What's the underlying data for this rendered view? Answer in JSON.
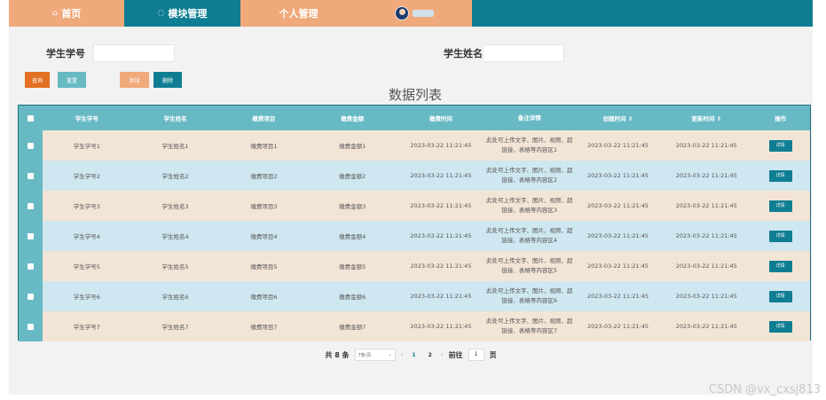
{
  "nav": {
    "home": "首页",
    "module": "模块管理",
    "personal": "个人管理"
  },
  "search": {
    "student_no_label": "学生学号",
    "student_name_label": "学生姓名",
    "student_no_value": "",
    "student_name_value": ""
  },
  "buttons": {
    "query": "查询",
    "reset": "重置",
    "add": "添加",
    "delete": "删除"
  },
  "colors": {
    "orange": "#f0a97a",
    "teal": "#0f7e93",
    "query_btn": "#e37022",
    "reset_btn": "#67b9c4",
    "add_btn": "#f0a97a",
    "delete_btn": "#0f7e93"
  },
  "list_title": "数据列表",
  "table": {
    "headers": [
      "学生学号",
      "学生姓名",
      "缴费项目",
      "缴费金额",
      "缴费时间",
      "备注详情",
      "创建时间 ⇕",
      "更新时间 ⇕",
      "操作"
    ],
    "detail_label": "详情",
    "rows": [
      [
        "学生学号1",
        "学生姓名1",
        "缴费项目1",
        "缴费金额1",
        "2023-03-22 11:21:45",
        "此处可上传文字、图片、视频、超链接、表格等内容区1",
        "2023-03-22 11:21:45",
        "2023-03-22 11:21:45"
      ],
      [
        "学生学号2",
        "学生姓名2",
        "缴费项目2",
        "缴费金额2",
        "2023-03-22 11:21:45",
        "此处可上传文字、图片、视频、超链接、表格等内容区2",
        "2023-03-22 11:21:45",
        "2023-03-22 11:21:45"
      ],
      [
        "学生学号3",
        "学生姓名3",
        "缴费项目3",
        "缴费金额3",
        "2023-03-22 11:21:45",
        "此处可上传文字、图片、视频、超链接、表格等内容区3",
        "2023-03-22 11:21:45",
        "2023-03-22 11:21:45"
      ],
      [
        "学生学号4",
        "学生姓名4",
        "缴费项目4",
        "缴费金额4",
        "2023-03-22 11:21:45",
        "此处可上传文字、图片、视频、超链接、表格等内容区4",
        "2023-03-22 11:21:45",
        "2023-03-22 11:21:45"
      ],
      [
        "学生学号5",
        "学生姓名5",
        "缴费项目5",
        "缴费金额5",
        "2023-03-22 11:21:45",
        "此处可上传文字、图片、视频、超链接、表格等内容区5",
        "2023-03-22 11:21:45",
        "2023-03-22 11:21:45"
      ],
      [
        "学生学号6",
        "学生姓名6",
        "缴费项目6",
        "缴费金额6",
        "2023-03-22 11:21:45",
        "此处可上传文字、图片、视频、超链接、表格等内容区6",
        "2023-03-22 11:21:45",
        "2023-03-22 11:21:45"
      ],
      [
        "学生学号7",
        "学生姓名7",
        "缴费项目7",
        "缴费金额7",
        "2023-03-22 11:21:45",
        "此处可上传文字、图片、视频、超链接、表格等内容区7",
        "2023-03-22 11:21:45",
        "2023-03-22 11:21:45"
      ]
    ]
  },
  "pagination": {
    "total_text": "共 8 条",
    "page_size": "7条/页",
    "pages": [
      "1",
      "2"
    ],
    "goto_label": "前往",
    "goto_value": "1",
    "page_suffix": "页"
  },
  "watermark": "CSDN @vx_cxsj813"
}
